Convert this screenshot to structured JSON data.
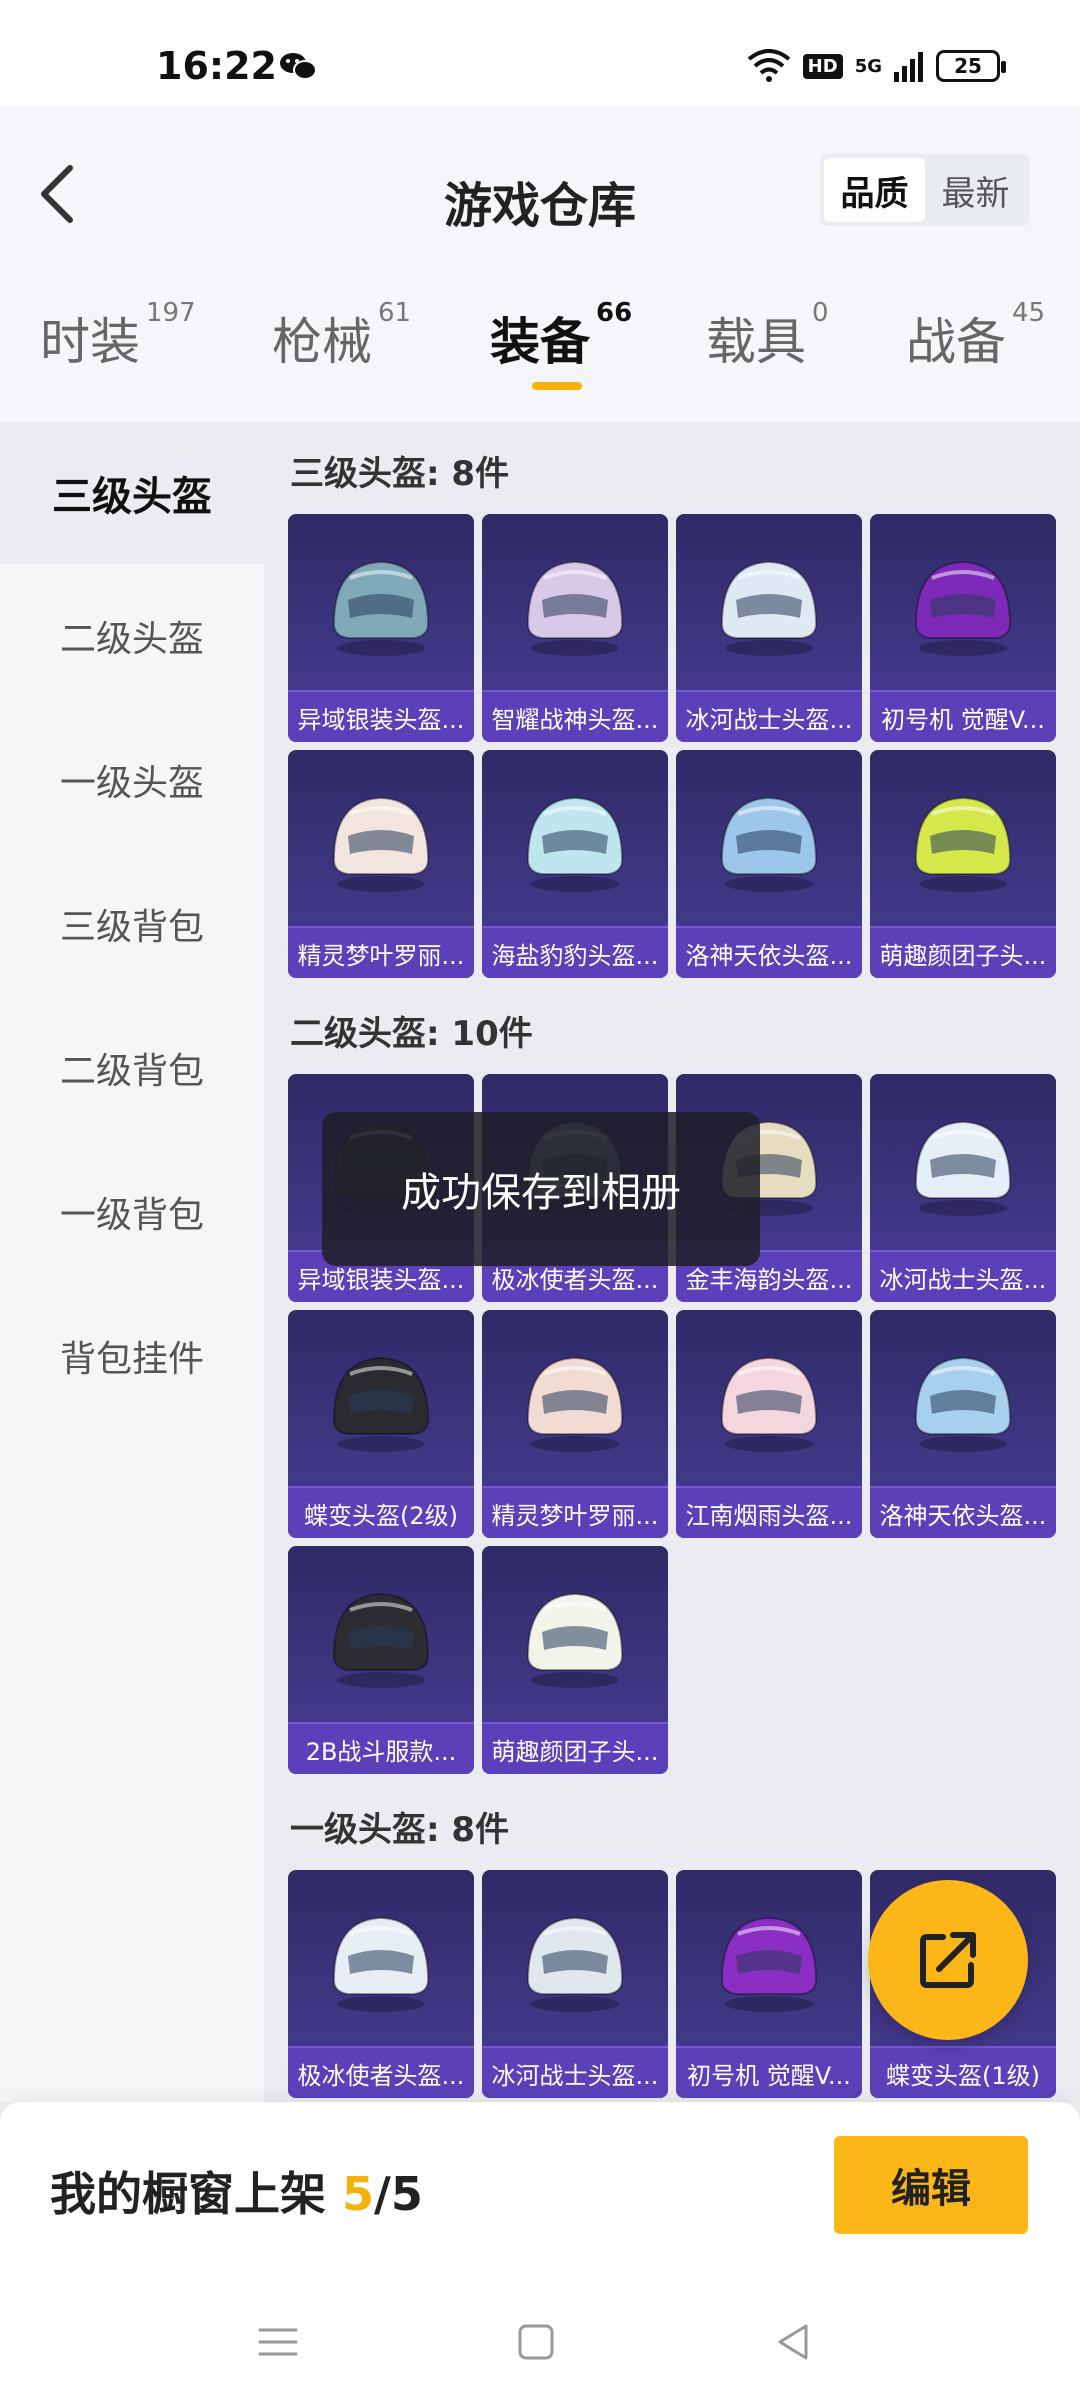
{
  "status_bar": {
    "time": "16:22",
    "hd": "HD",
    "net": "5G",
    "battery": "25"
  },
  "header": {
    "title": "游戏仓库",
    "sort_options": [
      "品质",
      "最新"
    ],
    "active_sort": "品质"
  },
  "tabs": [
    {
      "label": "时装",
      "count": "197"
    },
    {
      "label": "枪械",
      "count": "61"
    },
    {
      "label": "装备",
      "count": "66",
      "active": true
    },
    {
      "label": "载具",
      "count": "0"
    },
    {
      "label": "战备",
      "count": "45"
    }
  ],
  "sidebar": {
    "items": [
      "三级头盔",
      "二级头盔",
      "一级头盔",
      "三级背包",
      "二级背包",
      "一级背包",
      "背包挂件"
    ],
    "active": "三级头盔"
  },
  "sections": [
    {
      "title": "三级头盔: 8件",
      "items": [
        {
          "label": "异域银装头盔...",
          "color": "#7fa8b8",
          "icon": "helmet-icon"
        },
        {
          "label": "智耀战神头盔...",
          "color": "#d9c9e8",
          "icon": "helmet-icon"
        },
        {
          "label": "冰河战士头盔...",
          "color": "#dfe8f3",
          "icon": "helmet-icon"
        },
        {
          "label": "初号机 觉醒V...",
          "color": "#7d2ab8",
          "icon": "helmet-icon"
        },
        {
          "label": "精灵梦叶罗丽...",
          "color": "#f2e4de",
          "icon": "helmet-icon"
        },
        {
          "label": "海盐豹豹头盔...",
          "color": "#bfe6ef",
          "icon": "helmet-icon"
        },
        {
          "label": "洛神天依头盔...",
          "color": "#9cc6ea",
          "icon": "helmet-icon"
        },
        {
          "label": "萌趣颜团子头...",
          "color": "#d4e84a",
          "icon": "helmet-icon"
        }
      ]
    },
    {
      "title": "二级头盔: 10件",
      "items": [
        {
          "label": "异域银装头盔...",
          "color": "#3a3a44",
          "icon": "helmet-icon"
        },
        {
          "label": "极冰使者头盔...",
          "color": "#7d8fa3",
          "icon": "helmet-icon"
        },
        {
          "label": "金丰海韵头盔...",
          "color": "#e6dcc0",
          "icon": "helmet-icon"
        },
        {
          "label": "冰河战士头盔...",
          "color": "#e6eef7",
          "icon": "helmet-icon"
        },
        {
          "label": "蝶变头盔(2级)",
          "color": "#2a2a30",
          "icon": "helmet-icon"
        },
        {
          "label": "精灵梦叶罗丽...",
          "color": "#f1dcd4",
          "icon": "helmet-icon"
        },
        {
          "label": "江南烟雨头盔...",
          "color": "#f4d6de",
          "icon": "helmet-icon"
        },
        {
          "label": "洛神天依头盔...",
          "color": "#a7cfee",
          "icon": "helmet-icon"
        },
        {
          "label": "2B战斗服款...",
          "color": "#2c2c32",
          "icon": "helmet-icon"
        },
        {
          "label": "萌趣颜团子头...",
          "color": "#f2f4ea",
          "icon": "helmet-icon"
        }
      ]
    },
    {
      "title": "一级头盔: 8件",
      "items": [
        {
          "label": "极冰使者头盔...",
          "color": "#e7eef3",
          "icon": "helmet-icon"
        },
        {
          "label": "冰河战士头盔...",
          "color": "#e1e7ef",
          "icon": "helmet-icon"
        },
        {
          "label": "初号机 觉醒V...",
          "color": "#8a2ec4",
          "icon": "helmet-icon"
        },
        {
          "label": "蝶变头盔(1级)",
          "color": "#2a2a30",
          "icon": "helmet-icon"
        }
      ]
    }
  ],
  "toast": "成功保存到相册",
  "bottom": {
    "shelf_label": "我的橱窗上架 ",
    "shelf_current": "5",
    "shelf_total": "/5",
    "edit_label": "编辑"
  }
}
